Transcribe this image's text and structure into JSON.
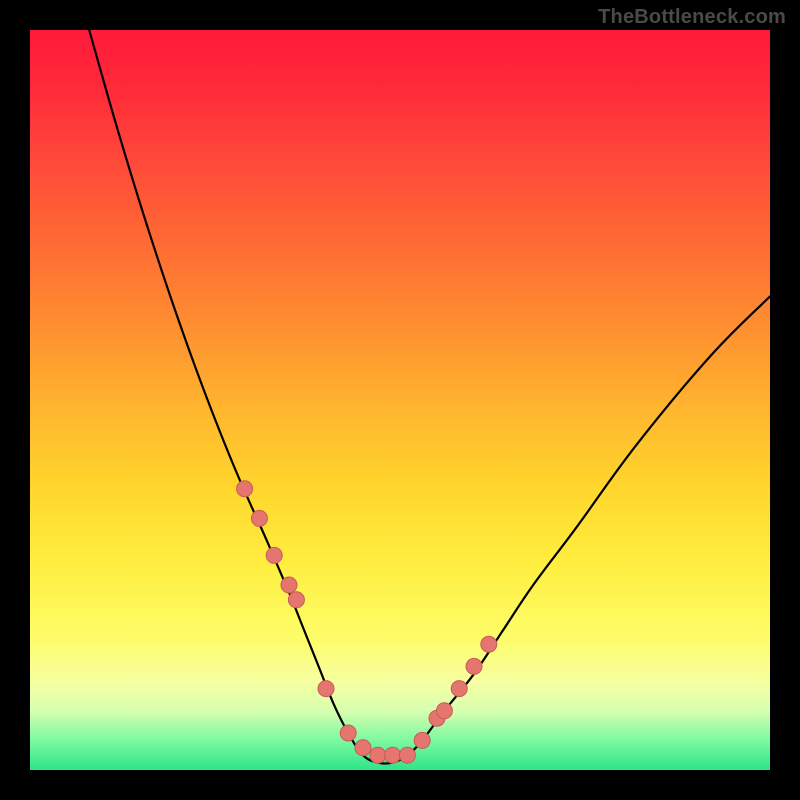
{
  "watermark": "TheBottleneck.com",
  "colors": {
    "frame": "#000000",
    "curve": "#000000",
    "marker_fill": "#e4766f",
    "marker_stroke": "#c95a54",
    "gradient_top": "#ff1a3a",
    "gradient_bottom": "#2de58a"
  },
  "chart_data": {
    "type": "line",
    "title": "",
    "xlabel": "",
    "ylabel": "",
    "xlim": [
      0,
      100
    ],
    "ylim": [
      0,
      100
    ],
    "grid": false,
    "legend": false,
    "series": [
      {
        "name": "bottleneck-curve",
        "x": [
          8,
          12,
          16,
          20,
          24,
          28,
          32,
          35,
          37,
          39,
          41,
          43,
          45,
          47,
          49,
          51,
          53,
          56,
          60,
          64,
          68,
          74,
          82,
          92,
          100
        ],
        "y": [
          100,
          86,
          73,
          61,
          50,
          40,
          31,
          24,
          19,
          14,
          9,
          5,
          2,
          1,
          1,
          2,
          4,
          8,
          13,
          19,
          25,
          33,
          44,
          56,
          64
        ]
      }
    ],
    "markers": {
      "name": "annotated-points",
      "x": [
        29,
        31,
        33,
        35,
        36,
        40,
        43,
        45,
        47,
        49,
        51,
        53,
        55,
        56,
        58,
        60,
        62
      ],
      "y": [
        38,
        34,
        29,
        25,
        23,
        11,
        5,
        3,
        2,
        2,
        2,
        4,
        7,
        8,
        11,
        14,
        17
      ]
    }
  }
}
